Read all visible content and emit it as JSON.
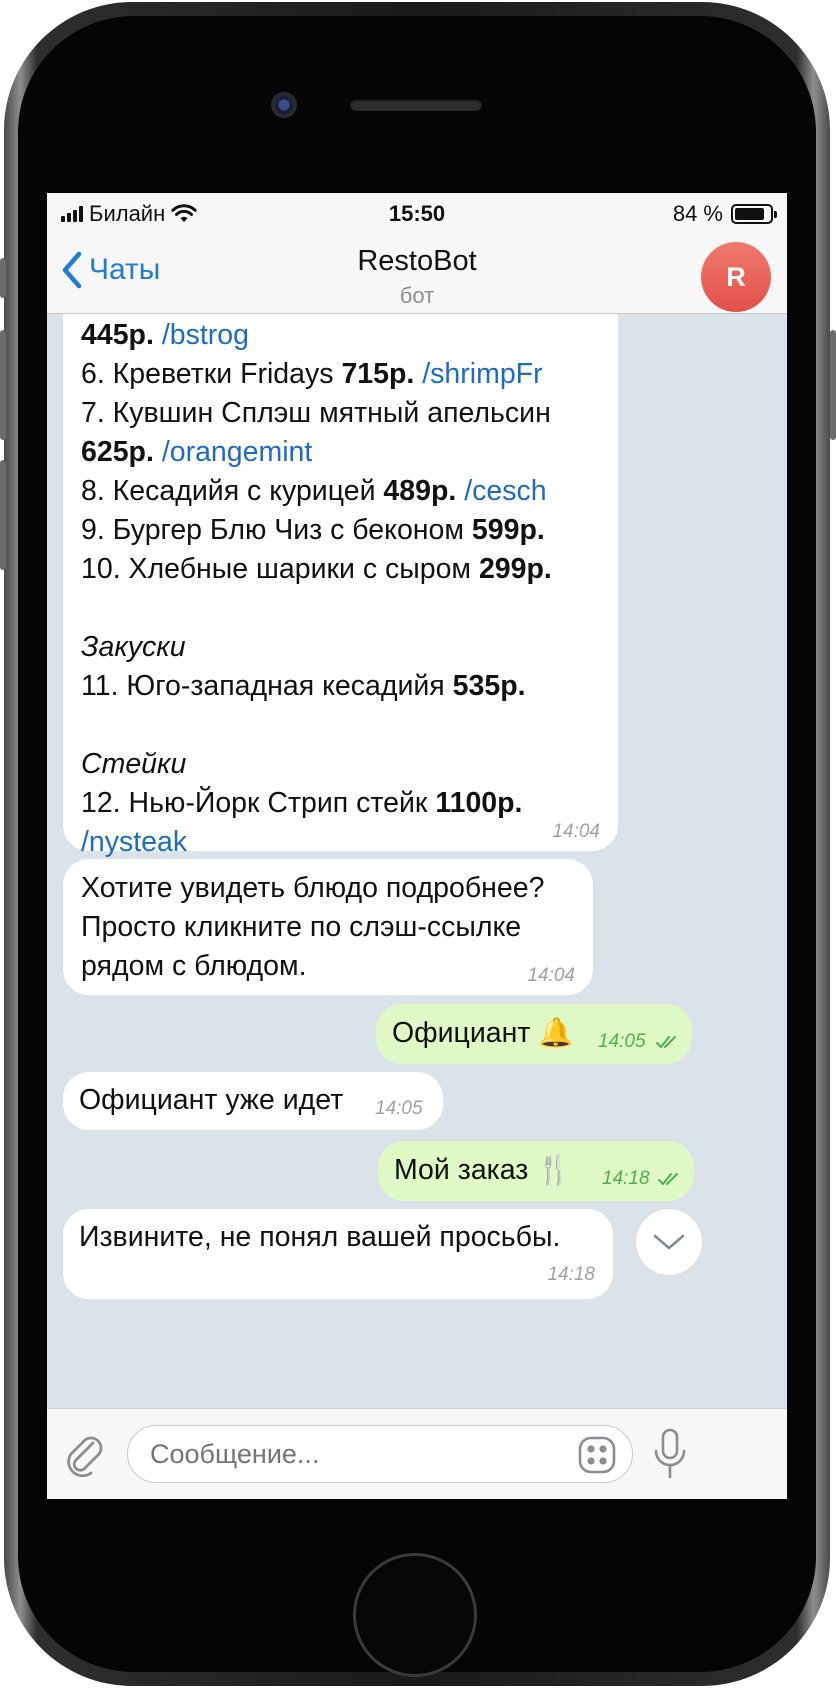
{
  "status": {
    "carrier": "Билайн",
    "time": "15:50",
    "battery": "84 %"
  },
  "header": {
    "back_label": "Чаты",
    "title": "RestoBot",
    "subtitle": "бот",
    "avatar_letter": "R"
  },
  "messages": {
    "menu": {
      "lines": {
        "l1": {
          "price": "445р.",
          "cmd": "/bstrog"
        },
        "l2": {
          "text": "6. Креветки Fridays",
          "price": "715р.",
          "cmd": "/shrimpFr"
        },
        "l3": {
          "text": "7. Кувшин Сплэш мятный апельсин"
        },
        "l4": {
          "price": "625р.",
          "cmd": "/orangemint"
        },
        "l5": {
          "text": "8. Кесадийя с курицей",
          "price": "489р.",
          "cmd": "/cesch"
        },
        "l6": {
          "text": "9. Бургер Блю Чиз с беконом",
          "price": "599р."
        },
        "l7": {
          "text": "10. Хлебные шарики с сыром",
          "price": "299р."
        },
        "l8": {
          "heading": "Закуски"
        },
        "l9": {
          "text": "11. Юго-западная кесадийя",
          "price": "535р."
        },
        "l10": {
          "heading": "Стейки"
        },
        "l11": {
          "text": "12. Нью-Йорк Стрип стейк",
          "price": "1100р."
        },
        "l12": {
          "cmd": "/nysteak"
        }
      },
      "time": "14:04"
    },
    "hint": {
      "line1": "Хотите увидеть блюдо подробнее?",
      "line2": "Просто кликните по слэш-ссылке",
      "line3": "рядом с блюдом.",
      "time": "14:04"
    },
    "waiter_out": {
      "text": "Официант 🔔",
      "time": "14:05"
    },
    "waiter_in": {
      "text": "Официант уже идет",
      "time": "14:05"
    },
    "order_out": {
      "text": "Мой заказ 🍴",
      "time": "14:18"
    },
    "not_understood": {
      "text": "Извините, не понял вашей просьбы.",
      "time": "14:18"
    }
  },
  "input": {
    "placeholder": "Сообщение..."
  },
  "colors": {
    "accent": "#1f7bd8",
    "outgoing_bubble": "#dff8c6",
    "chat_bg": "#dbe3ea",
    "avatar": "#e8574e",
    "check": "#4fae4e"
  },
  "icons": [
    "back-chevron",
    "wifi",
    "battery",
    "attach-paperclip",
    "sticker",
    "microphone",
    "scroll-down-chevron",
    "read-double-check",
    "bell",
    "fork-knife"
  ]
}
